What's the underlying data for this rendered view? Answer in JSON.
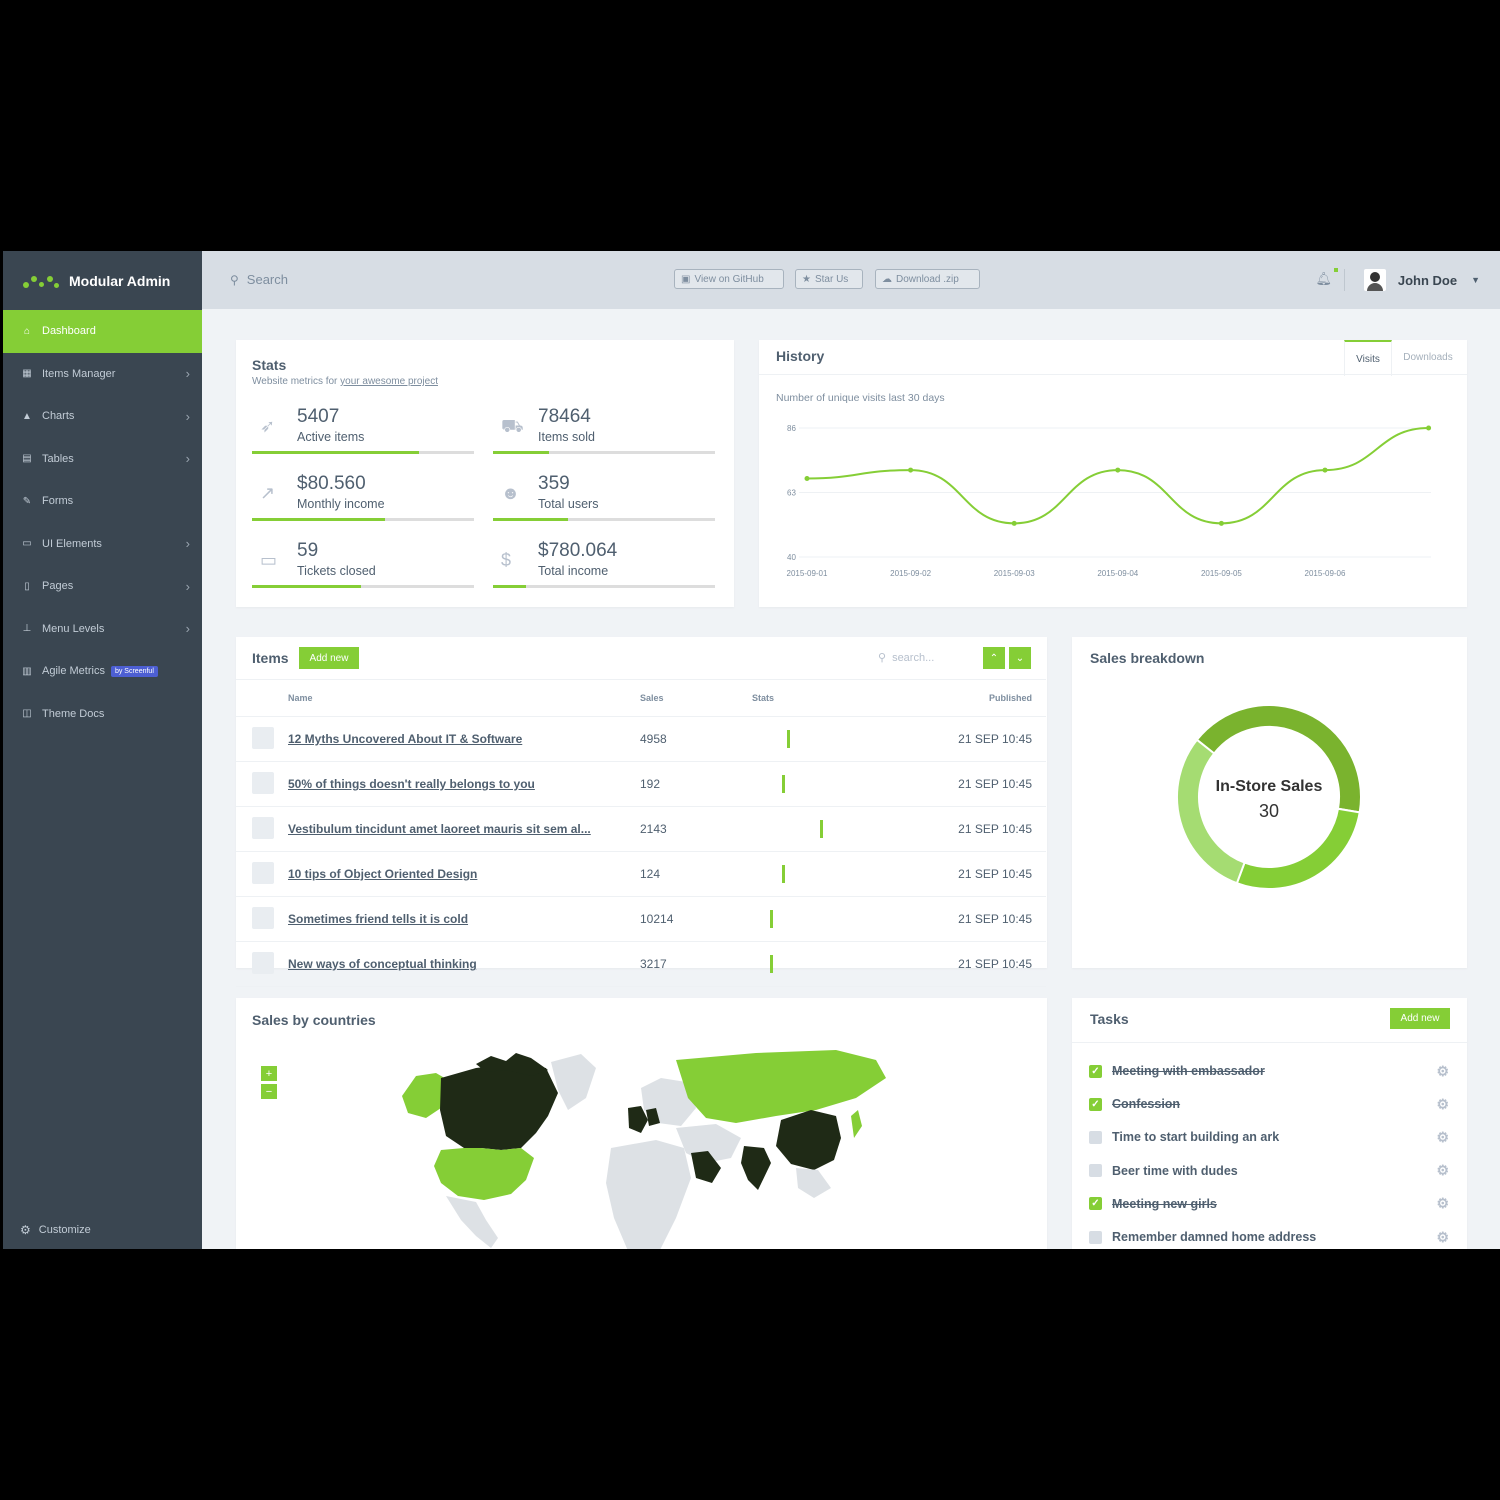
{
  "app": {
    "brand": "Modular Admin"
  },
  "sidebar": {
    "items": [
      {
        "label": "Dashboard",
        "icon": "home-icon",
        "glyph": "⌂",
        "active": true,
        "chevron": false
      },
      {
        "label": "Items Manager",
        "icon": "grid-icon",
        "glyph": "▦",
        "chevron": true
      },
      {
        "label": "Charts",
        "icon": "area-chart-icon",
        "glyph": "▲",
        "chevron": true
      },
      {
        "label": "Tables",
        "icon": "table-icon",
        "glyph": "▤",
        "chevron": true
      },
      {
        "label": "Forms",
        "icon": "edit-icon",
        "glyph": "✎",
        "chevron": false
      },
      {
        "label": "UI Elements",
        "icon": "desktop-icon",
        "glyph": "▭",
        "chevron": true
      },
      {
        "label": "Pages",
        "icon": "file-icon",
        "glyph": "▯",
        "chevron": true
      },
      {
        "label": "Menu Levels",
        "icon": "sitemap-icon",
        "glyph": "⊥",
        "chevron": true
      },
      {
        "label": "Agile Metrics",
        "icon": "bar-chart-icon",
        "glyph": "▥",
        "chevron": false,
        "badge": "by Screenful"
      },
      {
        "label": "Theme Docs",
        "icon": "book-icon",
        "glyph": "◫",
        "chevron": false
      }
    ],
    "customize": "Customize"
  },
  "topbar": {
    "search_placeholder": "Search",
    "github": "View on GitHub",
    "star": "Star Us",
    "download": "Download .zip",
    "user": "John Doe"
  },
  "stats": {
    "title": "Stats",
    "subtitle_prefix": "Website metrics for ",
    "subtitle_link": "your awesome project",
    "items": [
      {
        "value": "5407",
        "label": "Active items",
        "icon": "rocket-icon",
        "glyph": "➶",
        "progress": 0.75
      },
      {
        "value": "78464",
        "label": "Items sold",
        "icon": "cart-icon",
        "glyph": "⛟",
        "progress": 0.25
      },
      {
        "value": "$80.560",
        "label": "Monthly income",
        "icon": "line-chart-icon",
        "glyph": "↗",
        "progress": 0.6
      },
      {
        "value": "359",
        "label": "Total users",
        "icon": "users-icon",
        "glyph": "☻",
        "progress": 0.34
      },
      {
        "value": "59",
        "label": "Tickets closed",
        "icon": "ticket-icon",
        "glyph": "▭",
        "progress": 0.49
      },
      {
        "value": "$780.064",
        "label": "Total income",
        "icon": "dollar-icon",
        "glyph": "$",
        "progress": 0.15
      }
    ]
  },
  "history": {
    "title": "History",
    "tabs": [
      "Visits",
      "Downloads"
    ],
    "subtitle": "Number of unique visits last 30 days"
  },
  "chart_data": {
    "type": "line",
    "x": [
      "2015-09-01",
      "2015-09-02",
      "2015-09-03",
      "2015-09-04",
      "2015-09-05",
      "2015-09-06",
      "2015-09-07"
    ],
    "series": [
      {
        "values": [
          68,
          71,
          52,
          71,
          52,
          71,
          86
        ]
      }
    ],
    "yticks": [
      40,
      63,
      86
    ],
    "ylim": [
      40,
      86
    ],
    "xtick_labels": [
      "2015-09-01",
      "2015-09-02",
      "2015-09-03",
      "2015-09-04",
      "2015-09-05",
      "2015-09-06"
    ],
    "grid": true,
    "color": "#85ce36"
  },
  "items": {
    "title": "Items",
    "add_new": "Add new",
    "search_placeholder": "search...",
    "columns": [
      "Name",
      "Sales",
      "Stats",
      "Published"
    ],
    "rows": [
      {
        "name": "12 Myths Uncovered About IT & Software",
        "sales": "4958",
        "published": "21 SEP 10:45"
      },
      {
        "name": "50% of things doesn't really belongs to you",
        "sales": "192",
        "published": "21 SEP 10:45"
      },
      {
        "name": "Vestibulum tincidunt amet laoreet mauris sit sem al...",
        "sales": "2143",
        "published": "21 SEP 10:45"
      },
      {
        "name": "10 tips of Object Oriented Design",
        "sales": "124",
        "published": "21 SEP 10:45"
      },
      {
        "name": "Sometimes friend tells it is cold",
        "sales": "10214",
        "published": "21 SEP 10:45"
      },
      {
        "name": "New ways of conceptual thinking",
        "sales": "3217",
        "published": "21 SEP 10:45"
      }
    ]
  },
  "sales_breakdown": {
    "title": "Sales breakdown",
    "center_label": "In-Store Sales",
    "center_value": "30",
    "segments": [
      {
        "value": 42,
        "color": "#7ab32e"
      },
      {
        "value": 28,
        "color": "#85ce36"
      },
      {
        "value": 30,
        "color": "#a5dc72"
      }
    ]
  },
  "countries": {
    "title": "Sales by countries",
    "zoom_in": "+",
    "zoom_out": "−"
  },
  "tasks": {
    "title": "Tasks",
    "add_new": "Add new",
    "items": [
      {
        "text": "Meeting with embassador",
        "done": true
      },
      {
        "text": "Confession",
        "done": true
      },
      {
        "text": "Time to start building an ark",
        "done": false
      },
      {
        "text": "Beer time with dudes",
        "done": false
      },
      {
        "text": "Meeting new girls",
        "done": true
      },
      {
        "text": "Remember damned home address",
        "done": false
      }
    ]
  },
  "colors": {
    "accent": "#85ce36",
    "sidebar": "#3a4651",
    "dark_region": "#1f2a16",
    "light_region": "#dde1e5"
  }
}
